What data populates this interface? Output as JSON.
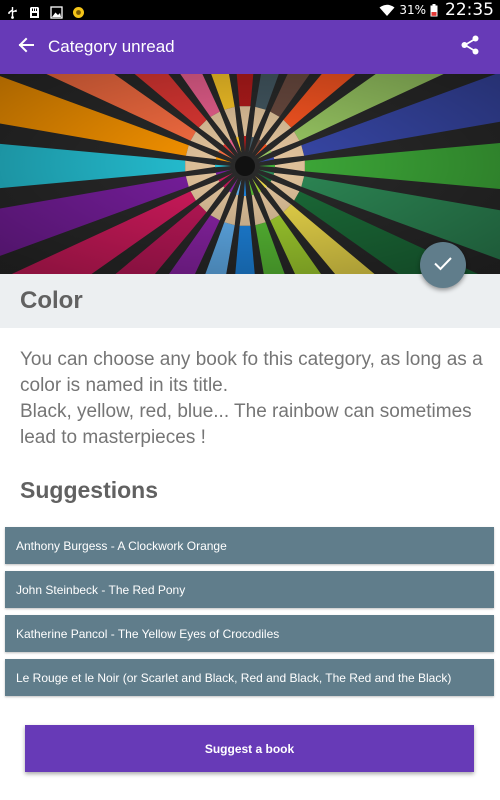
{
  "status_bar": {
    "battery": "31%",
    "time": "22:35",
    "icons": [
      "usb-icon",
      "sd-card-icon",
      "image-icon",
      "app-notification-icon",
      "wifi-icon",
      "battery-icon"
    ]
  },
  "app_bar": {
    "title": "Category unread",
    "back_icon": "arrow-back-icon",
    "share_icon": "share-icon",
    "color": "#673ab7"
  },
  "hero": {
    "description": "colored-pencils-image"
  },
  "fab": {
    "icon": "check-icon",
    "color": "#607d8b"
  },
  "category": {
    "title": "Color",
    "description": "You can choose any book fo this category, as long as a color is named in its title.\nBlack, yellow, red, blue... The rainbow can sometimes lead to masterpieces !"
  },
  "suggestions": {
    "heading": "Suggestions",
    "items": [
      "Anthony Burgess - A Clockwork Orange",
      "John Steinbeck - The Red Pony",
      "Katherine Pancol - The Yellow Eyes of Crocodiles",
      "Le Rouge et le Noir (or Scarlet and Black, Red and Black, The Red and the Black)"
    ]
  },
  "actions": {
    "suggest_label": "Suggest a book"
  }
}
